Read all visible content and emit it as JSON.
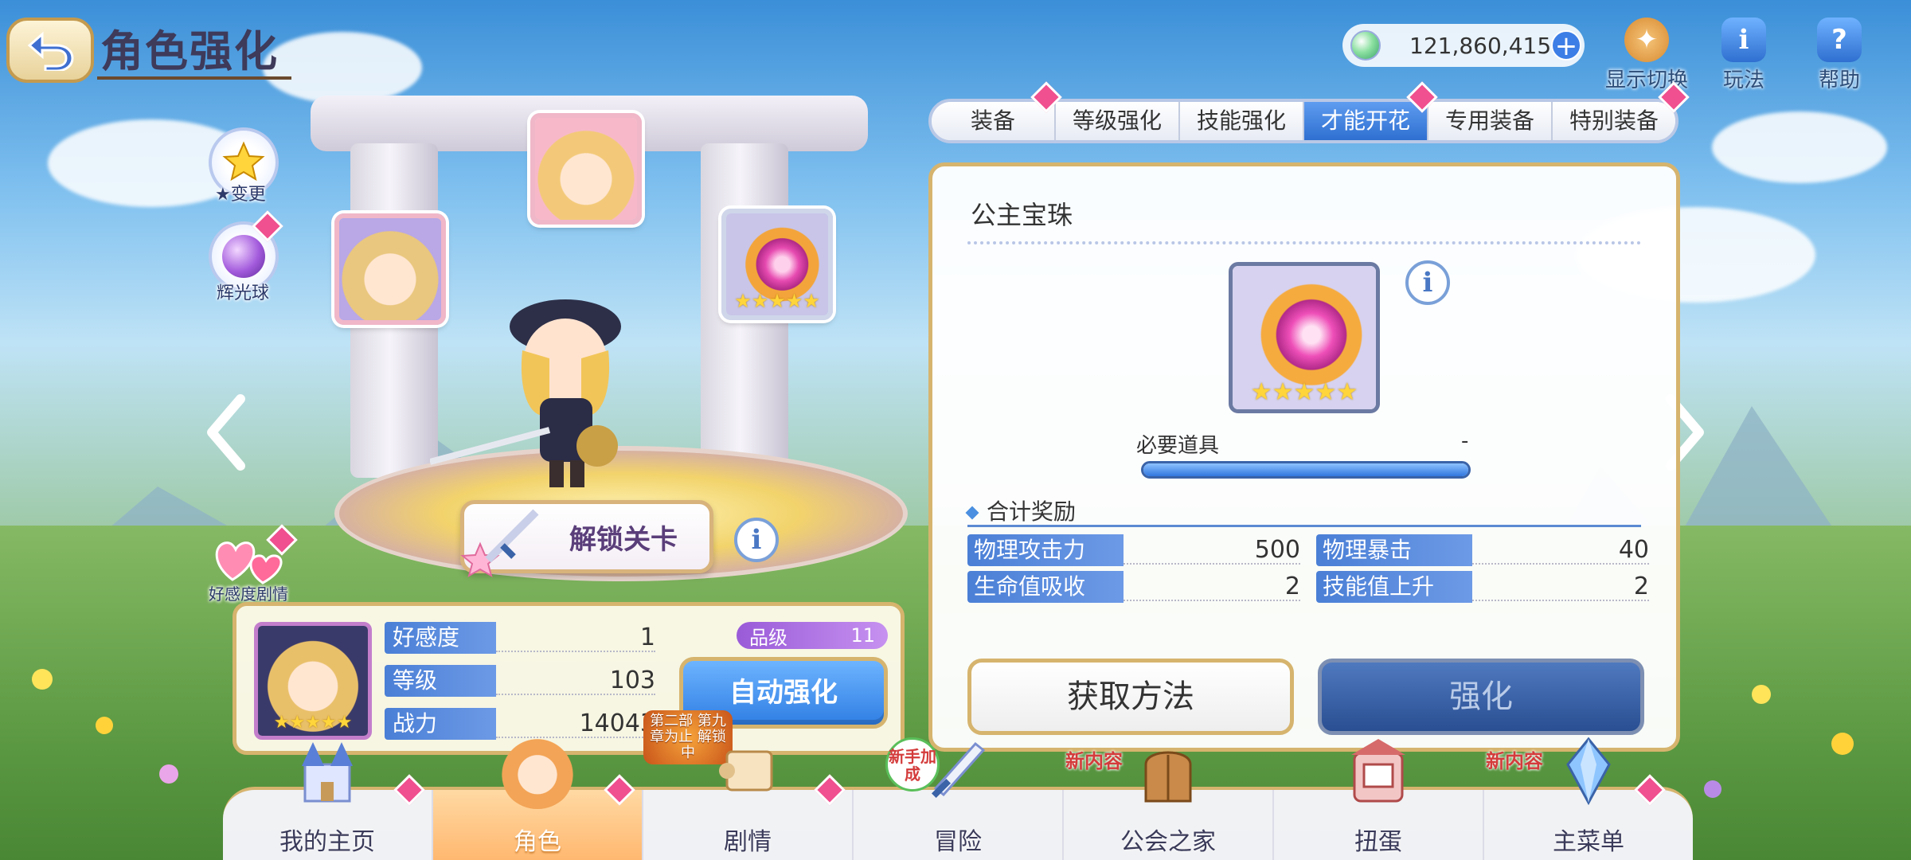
{
  "header": {
    "title": "角色强化",
    "currency_value": "121,860,415",
    "display_toggle_label": "显示切换",
    "gameplay_label": "玩法",
    "help_label": "帮助"
  },
  "side": {
    "star_change_label": "★变更",
    "glow_orb_label": "辉光球",
    "affection_story_label": "好感度剧情"
  },
  "unlock_stage_label": "解锁关卡",
  "character": {
    "card_stars": "★★★★★",
    "portrait_stars": "★★★★★",
    "rank_label": "品级",
    "rank_value": "11",
    "stats": [
      {
        "label": "好感度",
        "value": "1"
      },
      {
        "label": "等级",
        "value": "103"
      },
      {
        "label": "战力",
        "value": "14043"
      }
    ],
    "auto_enhance_label": "自动强化"
  },
  "tabs": [
    {
      "label": "装备",
      "active": false
    },
    {
      "label": "等级强化",
      "active": false
    },
    {
      "label": "技能强化",
      "active": false
    },
    {
      "label": "才能开花",
      "active": true
    },
    {
      "label": "专用装备",
      "active": false
    },
    {
      "label": "特别装备",
      "active": false
    }
  ],
  "panel": {
    "item_name": "公主宝珠",
    "item_stars": "★★★★★",
    "required_label": "必要道具",
    "required_value": "-",
    "required_progress": 1.0,
    "bonus_title": "合计奖励",
    "bonuses": [
      {
        "label": "物理攻击力",
        "value": "500"
      },
      {
        "label": "物理暴击",
        "value": "40"
      },
      {
        "label": "生命值吸收",
        "value": "2"
      },
      {
        "label": "技能值上升",
        "value": "2"
      }
    ],
    "obtain_label": "获取方法",
    "enhance_label": "强化"
  },
  "bottom_nav": {
    "items": [
      {
        "label": "我的主页",
        "active": false
      },
      {
        "label": "角色",
        "active": true
      },
      {
        "label": "剧情",
        "active": false
      },
      {
        "label": "冒险",
        "active": false
      },
      {
        "label": "公会之家",
        "active": false
      },
      {
        "label": "扭蛋",
        "active": false
      },
      {
        "label": "主菜单",
        "active": false
      }
    ],
    "new_content_badge": "新内容",
    "newbie_badge": "新手加成",
    "chapter_badge": "第二部 第九章为止 解锁中"
  },
  "colors": {
    "accent_blue": "#2f6fd0",
    "gold_border": "#d6b46e",
    "notification_pink": "#f0508f"
  },
  "icons": [
    "back-arrow-icon",
    "gem-icon",
    "plus-icon",
    "display-toggle-icon",
    "info-icon",
    "help-icon",
    "star-change-icon",
    "glow-orb-icon",
    "heart-icon",
    "left-arrow-icon",
    "right-arrow-icon",
    "princess-orb-icon"
  ]
}
